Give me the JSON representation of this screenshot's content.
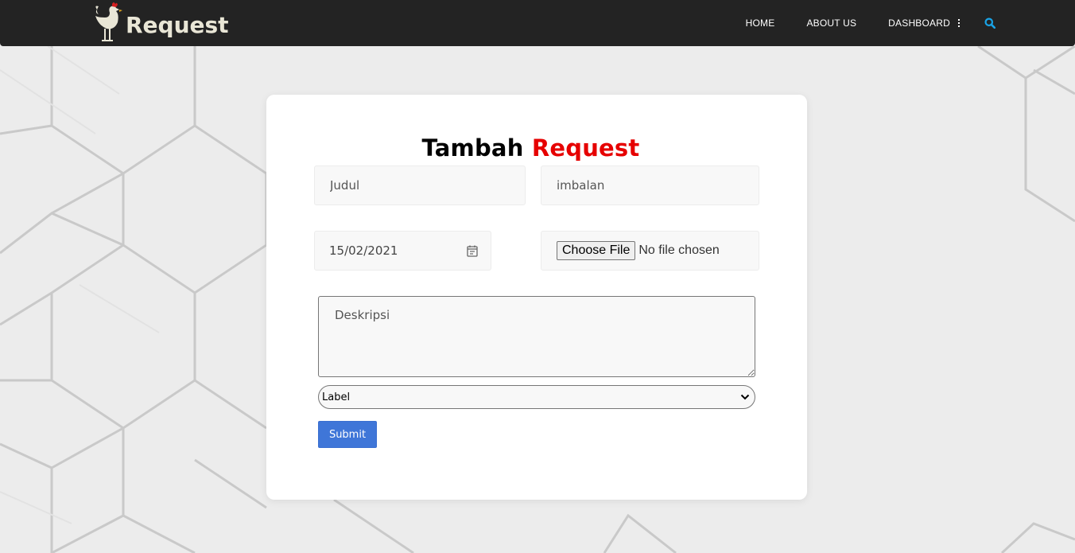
{
  "nav": {
    "brand": "Request",
    "links": [
      "HOME",
      "ABOUT US",
      "DASHBOARD"
    ],
    "icons": [
      "chicken-logo-icon",
      "vertical-dots-icon",
      "search-icon"
    ]
  },
  "form": {
    "title_main": "Tambah",
    "title_accent": "Request",
    "judul_placeholder": "Judul",
    "imbalan_placeholder": "imbalan",
    "date_value": "15/02/2021",
    "file_button": "Choose File",
    "file_status": "No file chosen",
    "deskripsi_placeholder": "Deskripsi",
    "label_selected": "Label",
    "submit_label": "Submit"
  },
  "colors": {
    "navbar": "#232323",
    "accent_red": "#e60000",
    "submit_blue": "#3f76d8",
    "search_icon": "#19a3e6"
  }
}
